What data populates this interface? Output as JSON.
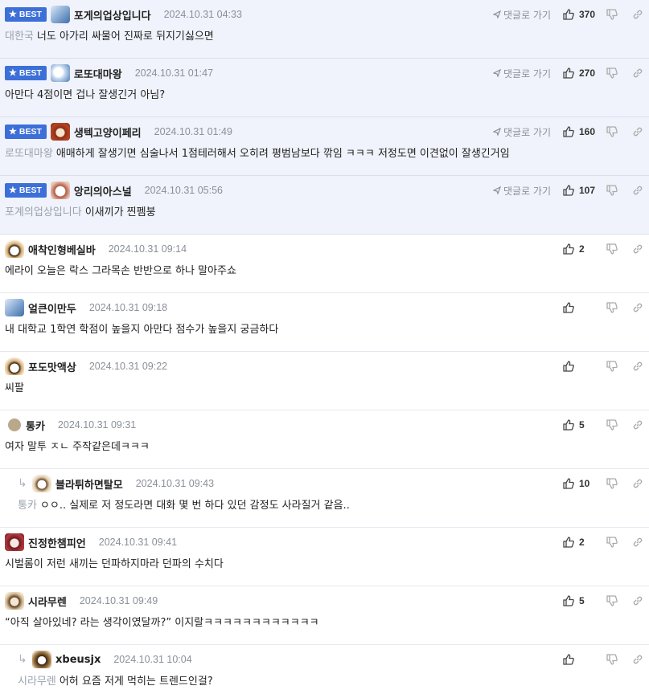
{
  "ui": {
    "best_label": "BEST",
    "goto_label": "댓글로 가기"
  },
  "comments": [
    {
      "best": true,
      "nick": "포게의업상입니다",
      "date": "2024.10.31 04:33",
      "likes": "370",
      "mention": "대한국",
      "text": "너도 아가리 싸물어 진짜로 뒤지기싫으면",
      "avatar": "bear-avatar"
    },
    {
      "best": true,
      "nick": "로또대마왕",
      "date": "2024.10.31 01:47",
      "likes": "270",
      "mention": "",
      "text": "아만다 4점이면 겁나 잘생긴거 아님?",
      "avatar": "bear-avatar"
    },
    {
      "best": true,
      "nick": "생텍고양이페리",
      "date": "2024.10.31 01:49",
      "likes": "160",
      "mention": "로또대마왕",
      "text": "애매하게 잘생기면 심술나서 1점테러해서 오히려 평범남보다 깎임 ㅋㅋㅋ 저정도면 이견없이 잘생긴거임",
      "avatar": "lion-avatar"
    },
    {
      "best": true,
      "nick": "앙리의아스널",
      "date": "2024.10.31 05:56",
      "likes": "107",
      "mention": "포계의업상입니다",
      "text": "이새끼가 찐펨붕",
      "avatar": "dog-avatar"
    },
    {
      "best": false,
      "nick": "애착인형베실바",
      "date": "2024.10.31 09:14",
      "likes": "2",
      "mention": "",
      "text": "에라이 오늘은 락스 그라목손 반반으로 하나 말아주쇼",
      "avatar": "fox-avatar"
    },
    {
      "best": false,
      "nick": "얼큰이만두",
      "date": "2024.10.31 09:18",
      "likes": "",
      "mention": "",
      "text": "내 대학교 1학연 학점이 높을지 아만다 점수가 높을지 궁금하다",
      "avatar": "bear-avatar"
    },
    {
      "best": false,
      "nick": "포도맛액상",
      "date": "2024.10.31 09:22",
      "likes": "",
      "mention": "",
      "text": "씨팔",
      "avatar": "fox-avatar"
    },
    {
      "best": false,
      "nick": "통카",
      "date": "2024.10.31 09:31",
      "likes": "5",
      "mention": "",
      "text": "여자 말투 ㅈㄴ 주작같은데ㅋㅋㅋ",
      "avatar": "dot-avatar"
    },
    {
      "best": false,
      "reply": true,
      "nick": "블라튀하면탈모",
      "date": "2024.10.31 09:43",
      "likes": "10",
      "mention": "통카",
      "text": "ㅇㅇ.. 실제로 저 정도라면 대화 몇 번 하다 있던 감정도 사라질거 같음..",
      "avatar": "puppy-avatar"
    },
    {
      "best": false,
      "nick": "진정한챔피언",
      "date": "2024.10.31 09:41",
      "likes": "2",
      "mention": "",
      "text": "시벌롬이 저런 새끼는 던파하지마라 던파의 수치다",
      "avatar": "red-avatar"
    },
    {
      "best": false,
      "nick": "시라무렌",
      "date": "2024.10.31 09:49",
      "likes": "5",
      "mention": "",
      "text": "“아직 살아있네? 라는 생각이였달까?” 이지랄ㅋㅋㅋㅋㅋㅋㅋㅋㅋㅋㅋㅋ",
      "avatar": "puppy-avatar"
    },
    {
      "best": false,
      "reply": true,
      "nick": "xbeusjx",
      "date": "2024.10.31 10:04",
      "likes": "",
      "mention": "시라무렌",
      "text": "어허 요즘 저게 먹히는 트렌드인걸?",
      "avatar": "puppy-avatar"
    }
  ]
}
